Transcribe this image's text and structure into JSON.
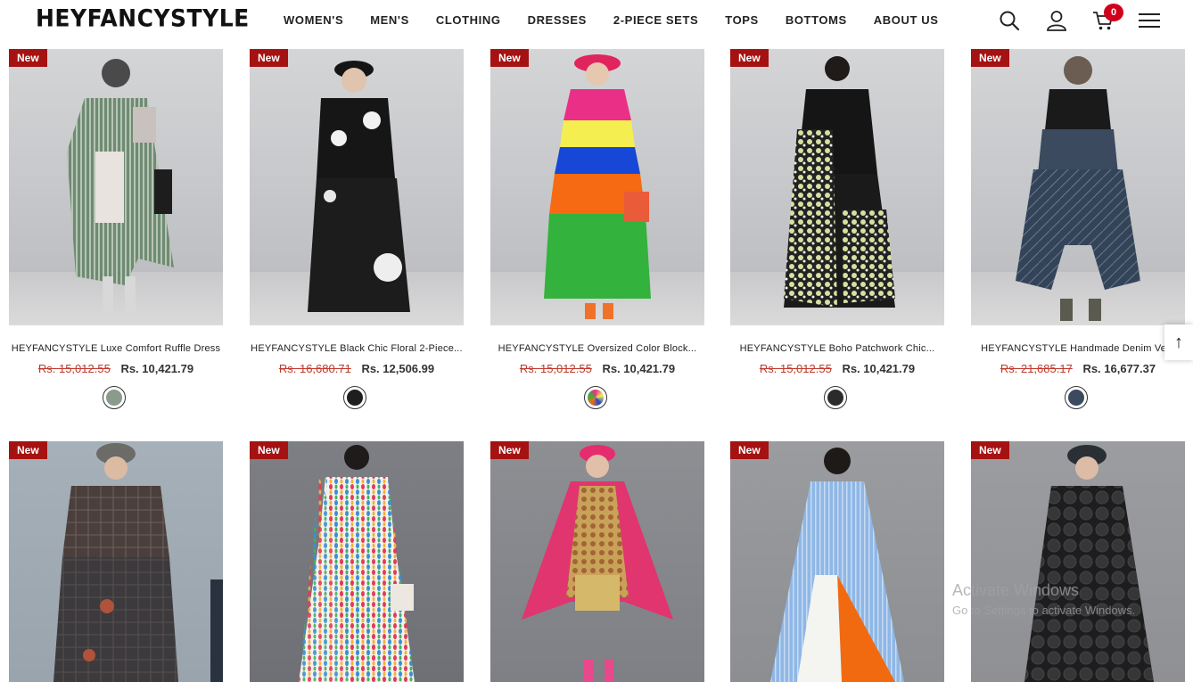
{
  "brand": {
    "logo_text": "HEYFANCYSTYLE"
  },
  "nav": [
    "WOMEN'S",
    "MEN'S",
    "CLOTHING",
    "DRESSES",
    "2-PIECE SETS",
    "TOPS",
    "BOTTOMS",
    "ABOUT US"
  ],
  "header": {
    "cart_count": "0",
    "icons": [
      "search-icon",
      "user-icon",
      "cart-icon",
      "menu-icon"
    ]
  },
  "products": [
    {
      "badge": "New",
      "title": "HEYFANCYSTYLE Luxe Comfort Ruffle Dress",
      "old_price": "Rs. 15,012.55",
      "price": "Rs. 10,421.79"
    },
    {
      "badge": "New",
      "title": "HEYFANCYSTYLE Black Chic Floral 2-Piece...",
      "old_price": "Rs. 16,680.71",
      "price": "Rs. 12,506.99"
    },
    {
      "badge": "New",
      "title": "HEYFANCYSTYLE Oversized Color Block...",
      "old_price": "Rs. 15,012.55",
      "price": "Rs. 10,421.79"
    },
    {
      "badge": "New",
      "title": "HEYFANCYSTYLE Boho Patchwork Chic...",
      "old_price": "Rs. 15,012.55",
      "price": "Rs. 10,421.79"
    },
    {
      "badge": "New",
      "title": "HEYFANCYSTYLE Handmade Denim Ve...",
      "old_price": "Rs. 21,685.17",
      "price": "Rs. 16,677.37"
    },
    {
      "badge": "New"
    },
    {
      "badge": "New"
    },
    {
      "badge": "New"
    },
    {
      "badge": "New"
    },
    {
      "badge": "New"
    }
  ],
  "colors": {
    "badge": "#a51212",
    "old_price": "#c0392b",
    "cart_badge": "#d0021b"
  },
  "watermark": {
    "line1": "Activate Windows",
    "line2": "Go to Settings to activate Windows."
  },
  "scroll_top": {
    "label": "↑"
  }
}
